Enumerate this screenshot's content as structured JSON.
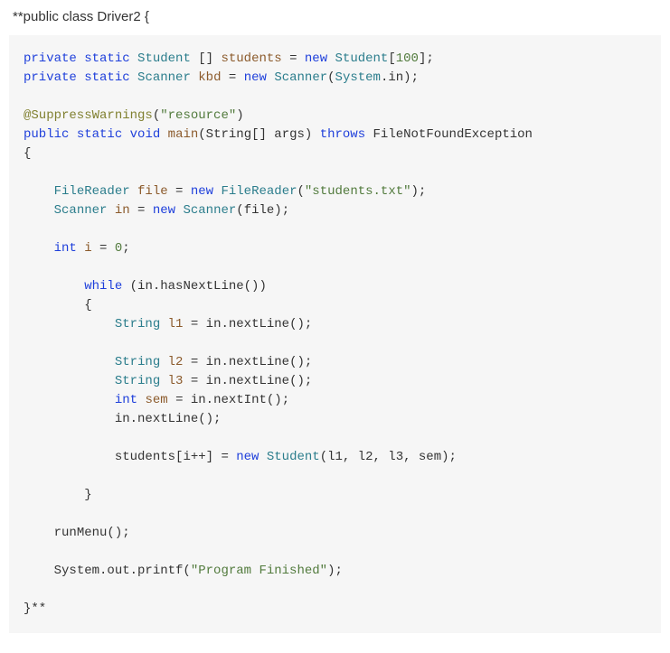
{
  "header": "**public class Driver2 {",
  "code": {
    "l01_private": "private",
    "l01_static": "static",
    "l01_type": "Student",
    "l01_arr": " [] ",
    "l01_var": "students",
    "l01_eq": " = ",
    "l01_new": "new",
    "l01_type2": " Student",
    "l01_br": "[",
    "l01_num": "100",
    "l01_end": "];",
    "l02_private": "private",
    "l02_static": "static",
    "l02_type": "Scanner",
    "l02_var": "kbd",
    "l02_eq": " = ",
    "l02_new": "new",
    "l02_type2": " Scanner",
    "l02_paren": "(",
    "l02_sys": "System",
    "l02_in": ".in);",
    "l04_anno": "@SuppressWarnings",
    "l04_paren": "(",
    "l04_str": "\"resource\"",
    "l04_close": ")",
    "l05_public": "public",
    "l05_static": "static",
    "l05_void": "void",
    "l05_main": "main",
    "l05_args": "(String[] args) ",
    "l05_throws": "throws",
    "l05_exc": " FileNotFoundException",
    "l06_brace": "{",
    "l08_type": "FileReader",
    "l08_var": "file",
    "l08_eq": " = ",
    "l08_new": "new",
    "l08_type2": " FileReader",
    "l08_paren": "(",
    "l08_str": "\"students.txt\"",
    "l08_close": ");",
    "l09_type": "Scanner",
    "l09_var": "in",
    "l09_eq": " = ",
    "l09_new": "new",
    "l09_type2": " Scanner",
    "l09_args": "(file);",
    "l11_int": "int",
    "l11_var": "i",
    "l11_eq": " = ",
    "l11_num": "0",
    "l11_semi": ";",
    "l13_while": "while",
    "l13_cond": " (in.hasNextLine())",
    "l14_brace": "{",
    "l15_type": "String",
    "l15_var": "l1",
    "l15_rest": " = in.nextLine();",
    "l17_type": "String",
    "l17_var": "l2",
    "l17_rest": " = in.nextLine();",
    "l18_type": "String",
    "l18_var": "l3",
    "l18_rest": " = in.nextLine();",
    "l19_int": "int",
    "l19_var": "sem",
    "l19_rest": " = in.nextInt();",
    "l20_rest": "in.nextLine();",
    "l22_arr": "students[i++] = ",
    "l22_new": "new",
    "l22_type": " Student",
    "l22_args": "(l1, l2, l3, sem);",
    "l24_brace": "}",
    "l26_run": "runMenu();",
    "l28_sys": "System.out.printf(",
    "l28_str": "\"Program Finished\"",
    "l28_close": ");",
    "l30_end": "}**"
  }
}
